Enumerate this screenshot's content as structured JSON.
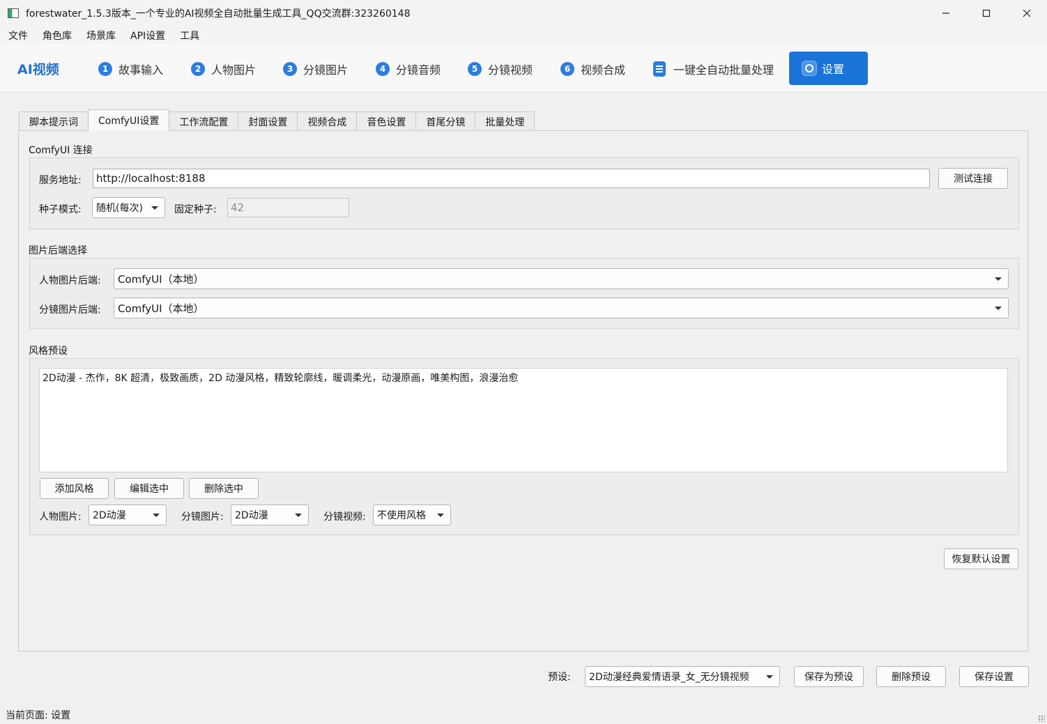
{
  "window": {
    "title": "forestwater_1.5.3版本_一个专业的AI视频全自动批量生成工具_QQ交流群:323260148"
  },
  "menu": [
    "文件",
    "角色库",
    "场景库",
    "API设置",
    "工具"
  ],
  "nav": {
    "brand": "AI视频",
    "steps": [
      {
        "num": "1",
        "label": "故事输入"
      },
      {
        "num": "2",
        "label": "人物图片"
      },
      {
        "num": "3",
        "label": "分镜图片"
      },
      {
        "num": "4",
        "label": "分镜音频"
      },
      {
        "num": "5",
        "label": "分镜视频"
      },
      {
        "num": "6",
        "label": "视频合成"
      }
    ],
    "batch_label": "一键全自动批量处理",
    "active_label": "设置"
  },
  "tabs": [
    "脚本提示词",
    "ComfyUI设置",
    "工作流配置",
    "封面设置",
    "视频合成",
    "音色设置",
    "首尾分镜",
    "批量处理"
  ],
  "comfy": {
    "group_title": "ComfyUI 连接",
    "server_label": "服务地址:",
    "server_value": "http://localhost:8188",
    "test_button": "测试连接",
    "seed_mode_label": "种子模式:",
    "seed_mode_value": "随机(每次)",
    "fixed_seed_label": "固定种子:",
    "fixed_seed_value": "42"
  },
  "backend": {
    "group_title": "图片后端选择",
    "character_label": "人物图片后端:",
    "character_value": "ComfyUI（本地）",
    "storyboard_label": "分镜图片后端:",
    "storyboard_value": "ComfyUI（本地）"
  },
  "style": {
    "group_title": "风格预设",
    "list_item": "2D动漫 - 杰作，8K 超清，极致画质，2D 动漫风格，精致轮廓线，暖调柔光，动漫原画，唯美构图，浪漫治愈",
    "add_button": "添加风格",
    "edit_button": "编辑选中",
    "delete_button": "删除选中",
    "character_label": "人物图片:",
    "character_value": "2D动漫",
    "storyboard_label": "分镜图片:",
    "storyboard_value": "2D动漫",
    "video_label": "分镜视频:",
    "video_value": "不使用风格"
  },
  "restore_button": "恢复默认设置",
  "footer": {
    "preset_label": "预设:",
    "preset_value": "2D动漫经典爱情语录_女_无分镜视频",
    "save_as_preset": "保存为预设",
    "delete_preset": "删除预设",
    "save_settings": "保存设置"
  },
  "status": "当前页面: 设置"
}
